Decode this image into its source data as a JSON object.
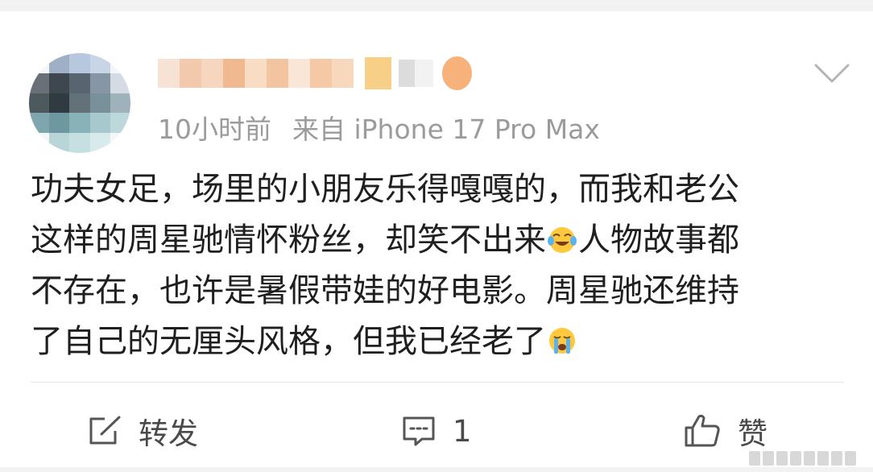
{
  "post": {
    "meta": {
      "time": "10小时前",
      "source": "来自 iPhone 17 Pro Max"
    },
    "content_lines": [
      "功夫女足，场里的小朋友乐得嘎嘎的，而我和老公",
      "这样的周星驰情怀粉丝，却笑不出来",
      "人物故事都",
      "不存在，也许是暑假带娃的好电影。周星驰还维持",
      "了自己的无厘头风格，但我已经老了"
    ],
    "emojis": [
      "laughing-crying-emoji",
      "crying-emoji"
    ]
  },
  "actions": {
    "repost_label": "转发",
    "comment_count": "1",
    "like_label": "赞"
  },
  "colors": {
    "text": "#1f1f1f",
    "meta": "#9b9b9b",
    "action": "#4a4a4a",
    "divider": "#e6e6e6",
    "background": "#f2f2f2"
  }
}
